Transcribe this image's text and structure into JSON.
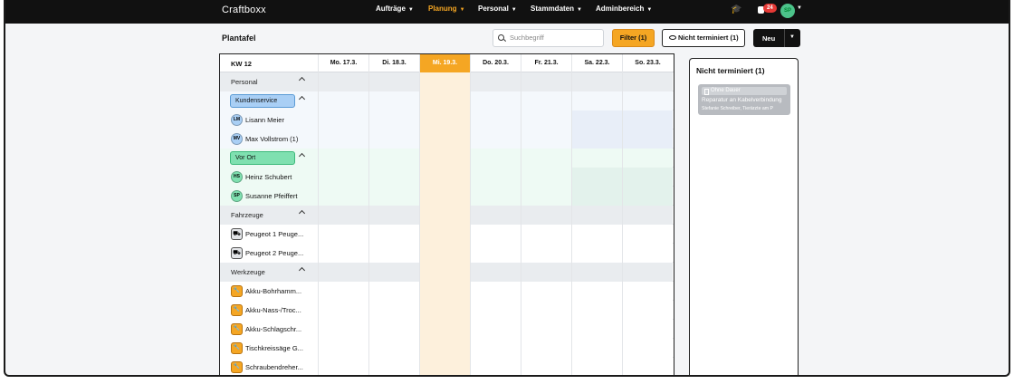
{
  "app": {
    "title": "Craftboxx"
  },
  "nav": {
    "items": [
      {
        "label": "Aufträge",
        "active": false
      },
      {
        "label": "Planung",
        "active": true
      },
      {
        "label": "Personal",
        "active": false
      },
      {
        "label": "Stammdaten",
        "active": false
      },
      {
        "label": "Adminbereich",
        "active": false
      }
    ],
    "notification_count": "24",
    "user_initials": "SP"
  },
  "page": {
    "title": "Plantafel"
  },
  "toolbar": {
    "search_placeholder": "Suchbegriff",
    "filter_label": "Filter (1)",
    "not_scheduled_label": "Nicht terminiert (1)",
    "new_label": "Neu"
  },
  "schedule": {
    "week_label": "KW 12",
    "days": [
      "Mo. 17.3.",
      "Di. 18.3.",
      "Mi. 19.3.",
      "Do. 20.3.",
      "Fr. 21.3.",
      "Sa. 22.3.",
      "So. 23.3."
    ],
    "today_index": 2,
    "rows": [
      {
        "kind": "group",
        "label": "Personal"
      },
      {
        "kind": "team",
        "label": "Kundenservice",
        "color": "#a9cff5",
        "border": "#5b9bd5",
        "tint": "#f4f8fc"
      },
      {
        "kind": "person",
        "initials": "LM",
        "label": "Lisann Meier",
        "color": "#a9cff5",
        "tint": "#f4f8fc"
      },
      {
        "kind": "person",
        "initials": "MV",
        "label": "Max Vollstrom (1)",
        "color": "#a9cff5",
        "tint": "#f4f8fc"
      },
      {
        "kind": "team",
        "label": "Vor Ort",
        "color": "#7fe0b0",
        "border": "#3cb97a",
        "tint": "#eefaf4"
      },
      {
        "kind": "person",
        "initials": "HS",
        "label": "Heinz Schubert",
        "color": "#7fe0b0",
        "tint": "#eefaf4"
      },
      {
        "kind": "person",
        "initials": "SP",
        "label": "Susanne Pfeiffert",
        "color": "#7fe0b0",
        "tint": "#eefaf4"
      },
      {
        "kind": "group",
        "label": "Fahrzeuge"
      },
      {
        "kind": "vehicle",
        "label": "Peugeot 1 Peuge..."
      },
      {
        "kind": "vehicle",
        "label": "Peugeot 2 Peuge..."
      },
      {
        "kind": "group",
        "label": "Werkzeuge"
      },
      {
        "kind": "tool",
        "label": "Akku-Bohrhamm..."
      },
      {
        "kind": "tool",
        "label": "Akku-Nass-/Troc..."
      },
      {
        "kind": "tool",
        "label": "Akku-Schlagschr..."
      },
      {
        "kind": "tool",
        "label": "Tischkreissäge G..."
      },
      {
        "kind": "tool",
        "label": "Schraubendreher..."
      }
    ]
  },
  "not_scheduled": {
    "title": "Nicht terminiert (1)",
    "card": {
      "duration": "Ohne Dauer",
      "title": "Reparatur an Kabelverbindung",
      "subtitle": "Stefanie Schreiber, Tierärzte am P"
    }
  },
  "colors": {
    "accent": "#f5a623",
    "topbar": "#111111",
    "group_bg": "#e9ecef",
    "today_tint": "#fdf0dc",
    "weekend_blue": "#e8eef8",
    "weekend_green": "#e3f2ec",
    "tool_icon": "#f5a623"
  },
  "icons": {
    "search": "search-icon",
    "eye": "eye-icon",
    "graduation": "graduation-cap-icon",
    "bell": "notification-bell-icon",
    "vehicle": "car-icon",
    "tool": "wrench-icon",
    "chevron": "chevron-up-icon"
  }
}
